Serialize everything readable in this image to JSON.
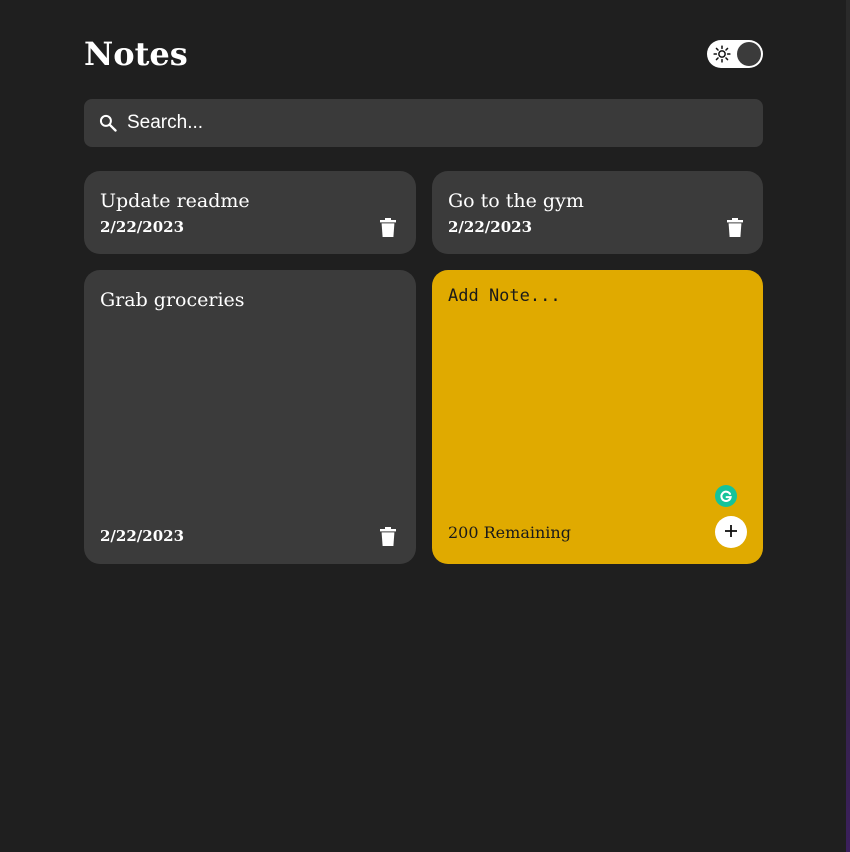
{
  "header": {
    "title": "Notes",
    "theme_toggle": {
      "icon": "sun-icon",
      "state": "dark"
    }
  },
  "search": {
    "placeholder": "Search...",
    "value": "",
    "icon": "search-icon"
  },
  "notes": [
    {
      "text": "Update readme",
      "date": "2/22/2023",
      "delete_icon": "trash-icon"
    },
    {
      "text": "Go to the gym",
      "date": "2/22/2023",
      "delete_icon": "trash-icon"
    },
    {
      "text": "Grab groceries",
      "date": "2/22/2023",
      "delete_icon": "trash-icon"
    }
  ],
  "new_note": {
    "placeholder": "Add Note...",
    "value": "",
    "remaining": "200 Remaining",
    "add_icon": "plus-icon",
    "grammarly_icon": "grammarly-icon"
  },
  "colors": {
    "background": "#1f1f1f",
    "card": "#3b3b3b",
    "new_note": "#e0aa00",
    "grammarly": "#15c39a"
  }
}
